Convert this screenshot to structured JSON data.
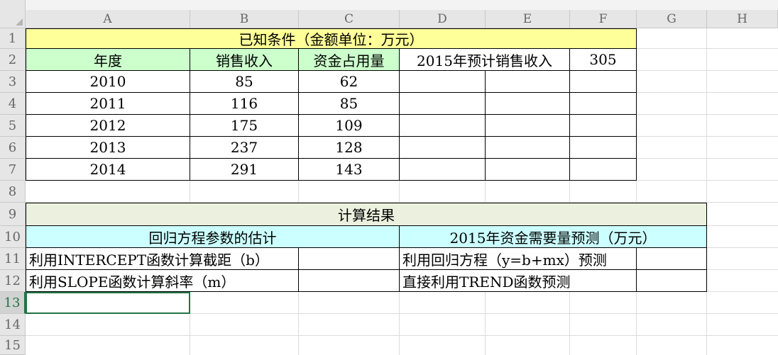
{
  "spreadsheet": {
    "columns": [
      "A",
      "B",
      "C",
      "D",
      "E",
      "F",
      "G",
      "H"
    ],
    "rows": [
      "1",
      "2",
      "3",
      "4",
      "5",
      "6",
      "7",
      "8",
      "9",
      "10",
      "11",
      "12",
      "13",
      "14",
      "15"
    ],
    "selected_row": "13",
    "colors": {
      "yellow": "#ffff99",
      "green": "#ccffcc",
      "gray_green": "#ebf1de",
      "cyan": "#ccffff",
      "selection": "#217346"
    }
  },
  "known": {
    "title": "已知条件（金额单位：万元）",
    "headers": [
      "年度",
      "销售收入",
      "资金占用量"
    ],
    "rows": [
      [
        "2010",
        "85",
        "62"
      ],
      [
        "2011",
        "116",
        "85"
      ],
      [
        "2012",
        "175",
        "109"
      ],
      [
        "2013",
        "237",
        "128"
      ],
      [
        "2014",
        "291",
        "143"
      ]
    ],
    "forecast_label": "2015年预计销售收入",
    "forecast_value": "305"
  },
  "results": {
    "title": "计算结果",
    "left_header": "回归方程参数的估计",
    "right_header": "2015年资金需要量预测（万元）",
    "row11_left": "利用INTERCEPT函数计算截距（b）",
    "row11_right": "利用回归方程（y=b+mx）预测",
    "row12_left": "利用SLOPE函数计算斜率（m）",
    "row12_right": "直接利用TREND函数预测"
  }
}
